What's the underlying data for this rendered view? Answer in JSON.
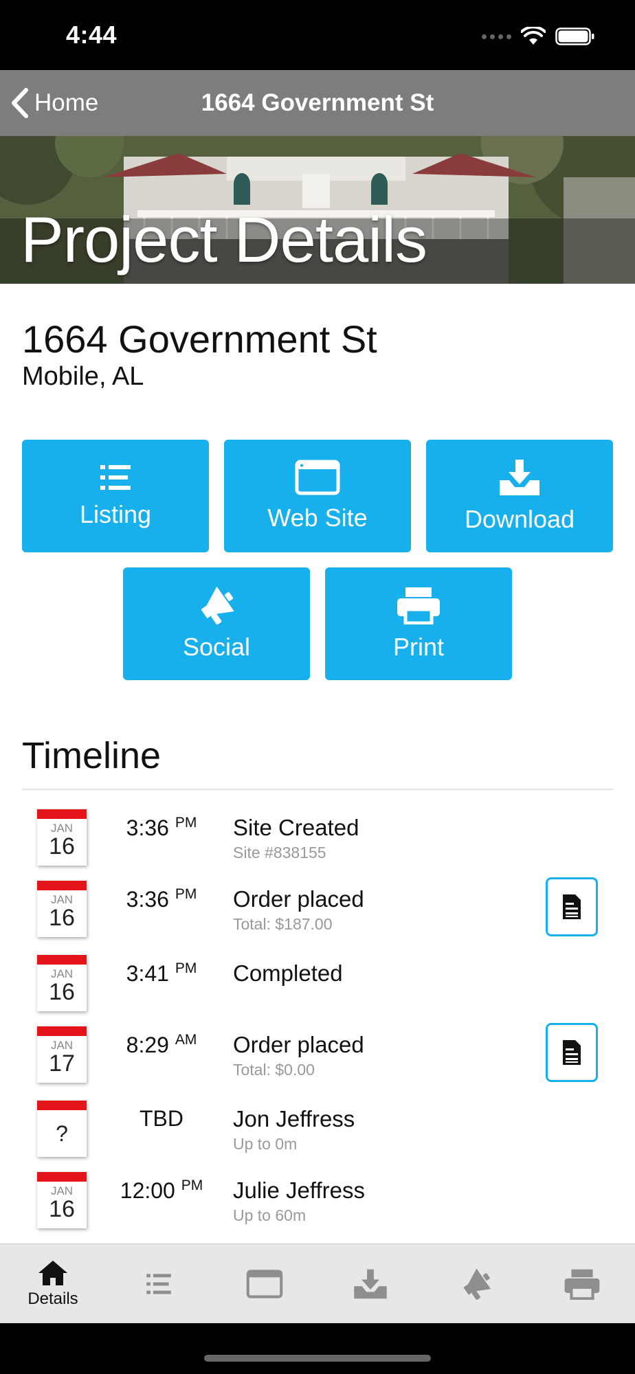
{
  "status_bar": {
    "time": "4:44"
  },
  "nav": {
    "back_label": "Home",
    "title": "1664 Government St"
  },
  "hero": {
    "title": "Project Details"
  },
  "project": {
    "address": "1664 Government St",
    "city": "Mobile, AL"
  },
  "actions": {
    "listing": "Listing",
    "website": "Web Site",
    "download": "Download",
    "social": "Social",
    "print": "Print"
  },
  "timeline": {
    "title": "Timeline",
    "items": [
      {
        "month": "JAN",
        "day": "16",
        "time": "3:36",
        "ampm": "PM",
        "title": "Site Created",
        "subtitle": "Site #838155",
        "has_doc": false
      },
      {
        "month": "JAN",
        "day": "16",
        "time": "3:36",
        "ampm": "PM",
        "title": "Order placed",
        "subtitle": "Total: $187.00",
        "has_doc": true
      },
      {
        "month": "JAN",
        "day": "16",
        "time": "3:41",
        "ampm": "PM",
        "title": "Completed",
        "subtitle": "",
        "has_doc": false
      },
      {
        "month": "JAN",
        "day": "17",
        "time": "8:29",
        "ampm": "AM",
        "title": "Order placed",
        "subtitle": "Total: $0.00",
        "has_doc": true
      },
      {
        "month": "",
        "day": "?",
        "time": "TBD",
        "ampm": "",
        "title": "Jon Jeffress",
        "subtitle": "Up to 0m",
        "has_doc": false
      },
      {
        "month": "JAN",
        "day": "16",
        "time": "12:00",
        "ampm": "PM",
        "title": "Julie Jeffress",
        "subtitle": "Up to 60m",
        "has_doc": false
      }
    ]
  },
  "tab_bar": {
    "details_label": "Details",
    "icons": [
      "home-icon",
      "list-icon",
      "browser-window-icon",
      "download-tray-icon",
      "megaphone-icon",
      "printer-icon"
    ]
  },
  "colors": {
    "accent": "#17b0ec",
    "calendar_red": "#e3151a",
    "nav_gray": "#7d7d7d",
    "tab_bar": "#e8e7e5"
  }
}
